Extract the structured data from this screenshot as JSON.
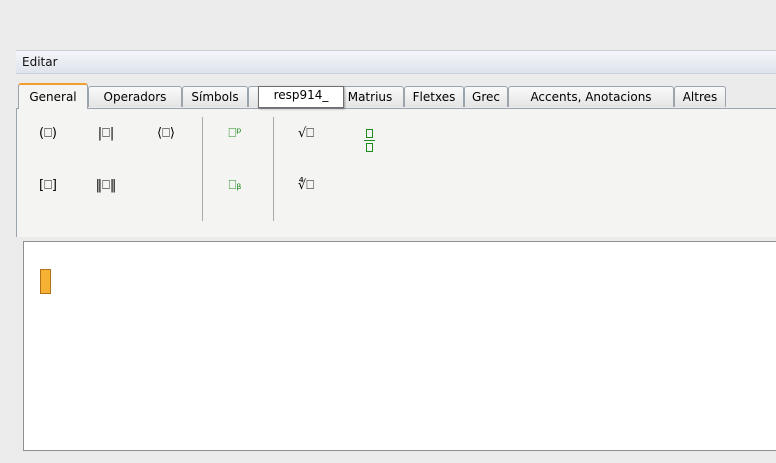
{
  "menu": {
    "label": "Editar"
  },
  "tabs": [
    {
      "label": "General",
      "active": true
    },
    {
      "label": "Operadors",
      "active": false
    },
    {
      "label": "Símbols",
      "active": false
    },
    {
      "label": "",
      "active": false
    },
    {
      "label": "Matrius",
      "active": false
    },
    {
      "label": "Fletxes",
      "active": false
    },
    {
      "label": "Grec",
      "active": false
    },
    {
      "label": "Accents, Anotacions",
      "active": false
    },
    {
      "label": "Altres",
      "active": false
    }
  ],
  "tooltip": {
    "text": "resp914_"
  },
  "toolbar": {
    "paren": "(⎕)",
    "abs": "|⎕|",
    "angle": "⟨⎕⟩",
    "bracket": "[⎕]",
    "norm": "‖⎕‖",
    "superscript": "⎕ᵖ",
    "subscript": "⎕ᵦ",
    "sqrt": "√⎕",
    "nthroot": "∜⎕"
  },
  "colors": {
    "accent": "#f0a030",
    "green": "#1d8c1d",
    "caret": "#f7b235"
  }
}
